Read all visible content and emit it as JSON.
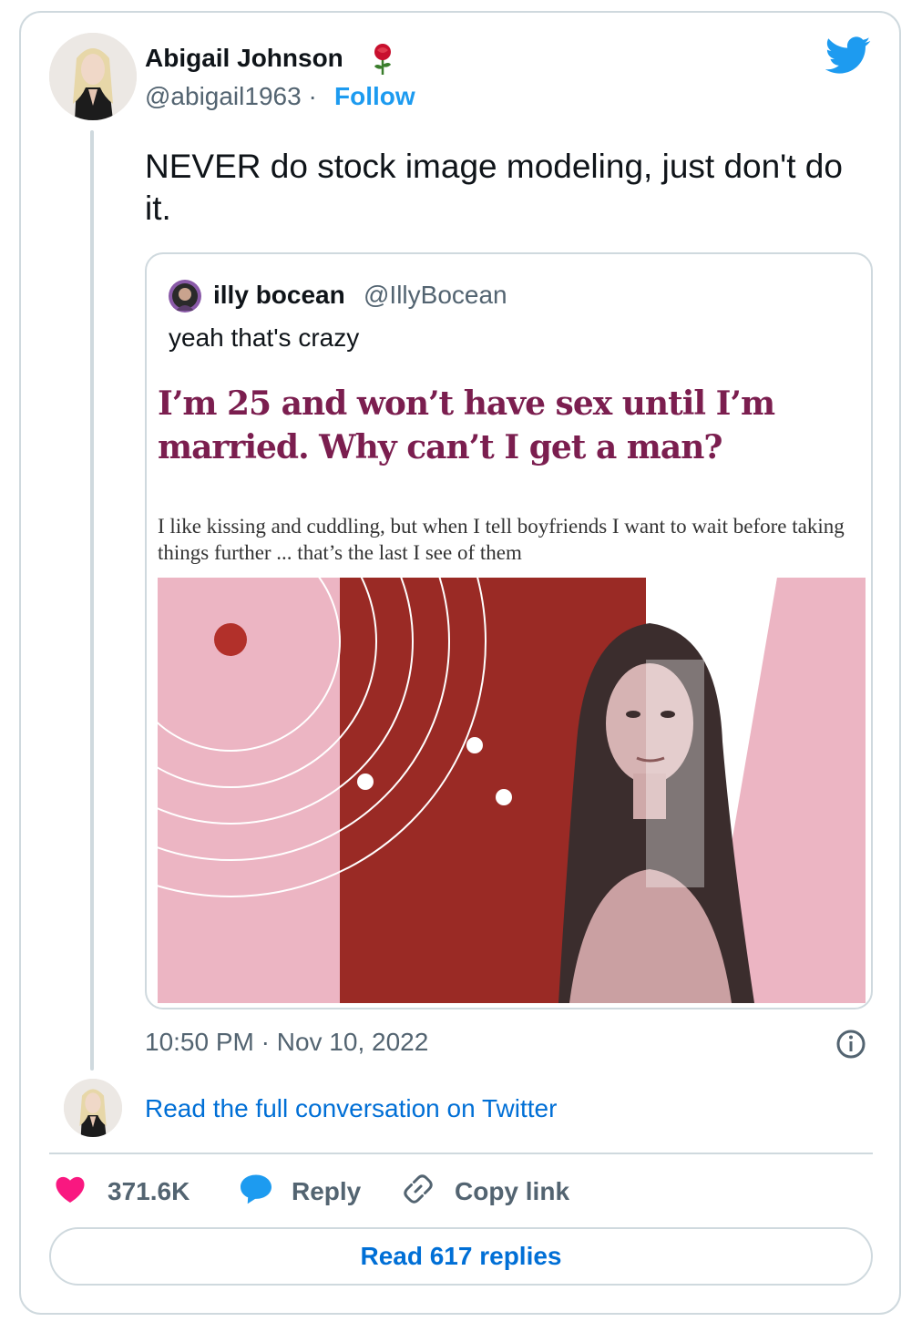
{
  "author": {
    "name": "Abigail Johnson",
    "emoji": "🌹",
    "handle": "@abigail1963",
    "separator": "·",
    "follow_label": "Follow"
  },
  "tweet": {
    "text": "NEVER do stock image modeling, just don't do it."
  },
  "quoted_tweet": {
    "name": "illy bocean",
    "handle": "@IllyBocean",
    "text": "yeah that's crazy",
    "article_headline": "I’m 25 and won’t have sex until I’m married. Why can’t I get a man?",
    "article_standfirst": "I like kissing and cuddling, but when I tell boyfriends I want to wait before taking things further ... that’s the last I see of them"
  },
  "timestamp": "10:50 PM · Nov 10, 2022",
  "read_full_label": "Read the full conversation on Twitter",
  "actions": {
    "like_count": "371.6K",
    "reply_label": "Reply",
    "copy_label": "Copy link"
  },
  "read_replies_label": "Read 617 replies",
  "icons": [
    "twitter-bird-icon",
    "rose-icon",
    "info-icon",
    "heart-icon",
    "reply-bubble-icon",
    "link-icon"
  ],
  "colors": {
    "link_blue": "#006fd6",
    "twitter_blue": "#1d9bf0",
    "like_pink": "#f91880",
    "headline_purple": "#7b1e4f",
    "art_pink": "#ecb5c3",
    "art_red": "#9a2a25"
  }
}
